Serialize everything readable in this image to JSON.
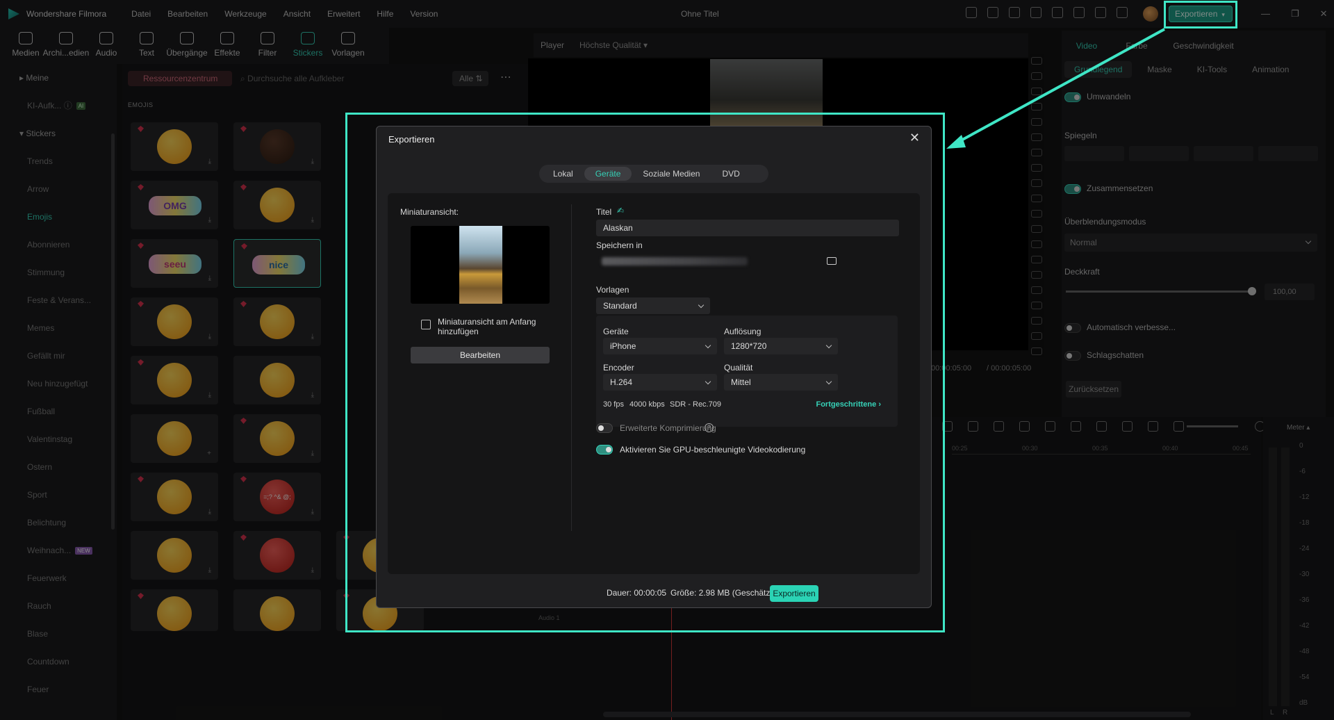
{
  "app": {
    "name": "Wondershare Filmora",
    "doc_title": "Ohne Titel",
    "menu": [
      "Datei",
      "Bearbeiten",
      "Werkzeuge",
      "Ansicht",
      "Erweitert",
      "Hilfe",
      "Version"
    ],
    "export_label": "Exportieren"
  },
  "toolbar": [
    "Medien",
    "Archi...edien",
    "Audio",
    "Text",
    "Übergänge",
    "Effekte",
    "Filter",
    "Stickers",
    "Vorlagen"
  ],
  "toolbar_active": "Stickers",
  "sidebar": {
    "items": [
      "Meine",
      "KI-Aufk...",
      "Stickers",
      "Trends",
      "Arrow",
      "Emojis",
      "Abonnieren",
      "Stimmung",
      "Feste & Verans...",
      "Memes",
      "Gefällt mir",
      "Neu hinzugefügt",
      "Fußball",
      "Valentinstag",
      "Ostern",
      "Sport",
      "Belichtung",
      "Weihnach...",
      "Feuerwerk",
      "Rauch",
      "Blase",
      "Countdown",
      "Feuer"
    ],
    "ai_badge": "AI",
    "new_badge": "NEW"
  },
  "browser": {
    "resource_center": "Ressourcenzentrum",
    "search_placeholder": "Durchsuche alle Aufkleber",
    "filter_label": "Alle",
    "section_label": "EMOJIS",
    "sticker_texts": [
      "OMG",
      "seeu",
      "nice",
      "=;? ^& @;"
    ]
  },
  "player": {
    "label": "Player",
    "quality": "Höchste Qualität",
    "time_current": "00:00:05:00",
    "time_total": "/ 00:00:05:00"
  },
  "right_panel": {
    "tabs": [
      "Video",
      "Farbe",
      "Geschwindigkeit"
    ],
    "subtabs": [
      "Grundlegend",
      "Maske",
      "KI-Tools",
      "Animation"
    ],
    "transform": "Umwandeln",
    "mirror": "Spiegeln",
    "compose": "Zusammensetzen",
    "blend_mode": "Überblendungsmodus",
    "blend_value": "Normal",
    "opacity": "Deckkraft",
    "opacity_value": "100,00",
    "auto_enhance": "Automatisch verbesse...",
    "drop_shadow": "Schlagschatten",
    "reset": "Zurücksetzen"
  },
  "timeline": {
    "ruler": [
      "00:25",
      "00:30",
      "00:35",
      "00:40",
      "00:45"
    ],
    "meter_label": "Meter",
    "meter_scale": [
      "0",
      "-6",
      "-12",
      "-18",
      "-24",
      "-30",
      "-36",
      "-42",
      "-48",
      "-54",
      "dB"
    ],
    "meter_lr": [
      "L",
      "R"
    ],
    "audio_track": "Audio 1"
  },
  "dialog": {
    "title": "Exportieren",
    "tabs": [
      "Lokal",
      "Geräte",
      "Soziale Medien",
      "DVD"
    ],
    "active_tab": "Geräte",
    "thumbnail_label": "Miniaturansicht:",
    "thumbnail_checkbox": "Miniaturansicht am Anfang hinzufügen",
    "edit_button": "Bearbeiten",
    "title_label": "Titel",
    "title_value": "Alaskan",
    "save_label": "Speichern in",
    "presets_label": "Vorlagen",
    "preset_value": "Standard",
    "device_label": "Geräte",
    "device_value": "iPhone",
    "resolution_label": "Auflösung",
    "resolution_value": "1280*720",
    "encoder_label": "Encoder",
    "encoder_value": "H.264",
    "quality_label": "Qualität",
    "quality_value": "Mittel",
    "fps": "30 fps",
    "bitrate": "4000 kbps",
    "color": "SDR - Rec.709",
    "advanced": "Fortgeschrittene",
    "ext_compression": "Erweiterte Komprimierung",
    "gpu_label": "Aktivieren Sie GPU-beschleunigte Videokodierung",
    "duration": "Dauer: 00:00:05",
    "size": "Größe: 2.98 MB (Geschätzt)",
    "export_button": "Exportieren"
  },
  "colors": {
    "accent": "#36d1b7",
    "highlight": "#3fe6c6",
    "export_button": "#2bd3b5"
  }
}
